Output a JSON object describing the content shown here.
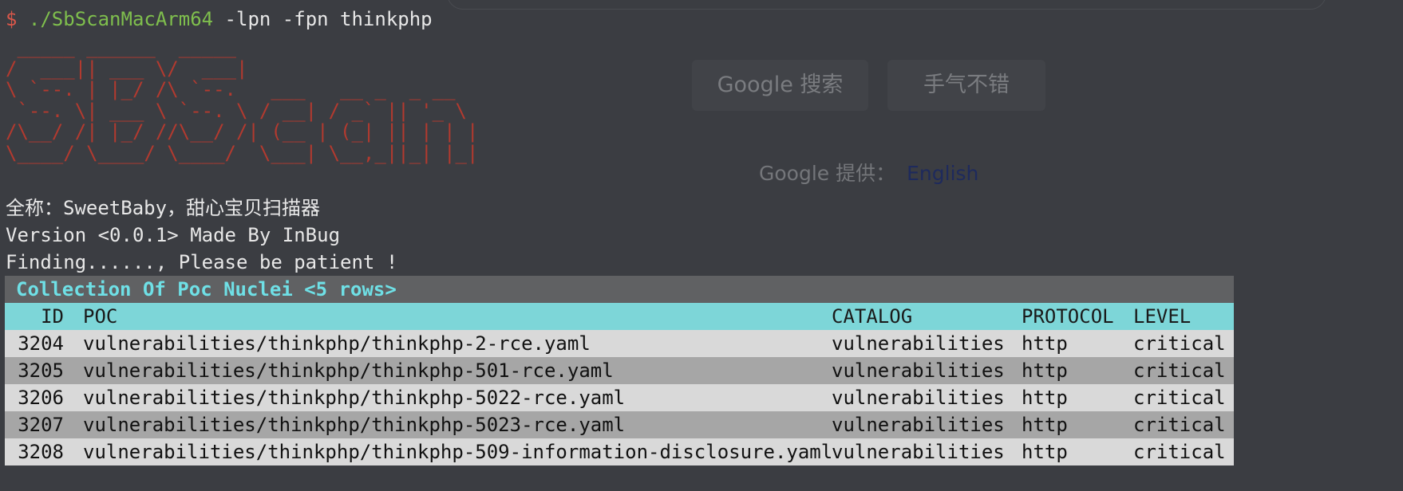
{
  "background_page": {
    "button_search": "Google 搜索",
    "button_lucky": "手气不错",
    "provided_by": "Google 提供：",
    "language_link": "English"
  },
  "terminal": {
    "prompt_symbol": "$",
    "command": "./SbScanMacArm64",
    "args": " -lpn -fpn thinkphp",
    "banner_art": [
      " _____ ______  _____",
      "/  ___|| ___ \\/  ___|",
      "\\ `--. | |_/ /\\ `--.   ___   __ _  _ __",
      " `--. \\| ___ \\ `--. \\ / __| / _` || '_ \\",
      "/\\__/ /| |_/ //\\__/ /| (__ | (_| || | | |",
      "\\____/ \\____/ \\____/  \\___| \\__,_||_| |_|"
    ],
    "info_fullname": "全称：SweetBaby，甜心宝贝扫描器",
    "info_version": "Version <0.0.1> Made By InBug",
    "info_finding": "Finding......, Please be patient !"
  },
  "table": {
    "title": "Collection Of Poc Nuclei <5 rows>",
    "columns": [
      "ID",
      "POC",
      "CATALOG",
      "PROTOCOL",
      "LEVEL"
    ],
    "rows": [
      {
        "id": "3204",
        "poc": "vulnerabilities/thinkphp/thinkphp-2-rce.yaml",
        "catalog": "vulnerabilities",
        "protocol": "http",
        "level": "critical"
      },
      {
        "id": "3205",
        "poc": "vulnerabilities/thinkphp/thinkphp-501-rce.yaml",
        "catalog": "vulnerabilities",
        "protocol": "http",
        "level": "critical"
      },
      {
        "id": "3206",
        "poc": "vulnerabilities/thinkphp/thinkphp-5022-rce.yaml",
        "catalog": "vulnerabilities",
        "protocol": "http",
        "level": "critical"
      },
      {
        "id": "3207",
        "poc": "vulnerabilities/thinkphp/thinkphp-5023-rce.yaml",
        "catalog": "vulnerabilities",
        "protocol": "http",
        "level": "critical"
      },
      {
        "id": "3208",
        "poc": "vulnerabilities/thinkphp/thinkphp-509-information-disclosure.yaml",
        "catalog": "vulnerabilities",
        "protocol": "http",
        "level": "critical"
      }
    ]
  },
  "colors": {
    "terminal_bg": "#3b3d42",
    "prompt_red": "#d9574a",
    "command_green": "#7fbf4d",
    "banner_red": "#b33a2f",
    "title_cyan": "#6fe0e6",
    "header_cyan": "#7dd6d8"
  }
}
